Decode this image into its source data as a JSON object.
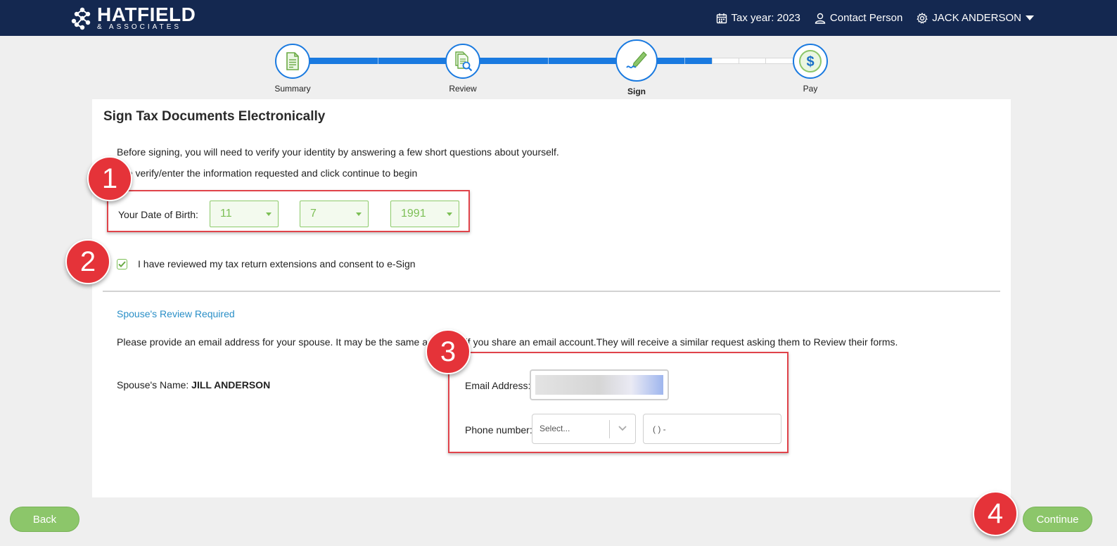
{
  "header": {
    "brand_name": "HATFIELD",
    "brand_sub": "& ASSOCIATES",
    "tax_year": "Tax year: 2023",
    "contact": "Contact Person",
    "user": "JACK ANDERSON"
  },
  "stepper": {
    "steps": [
      {
        "label": "Summary",
        "icon": "document-icon"
      },
      {
        "label": "Review",
        "icon": "review-search-icon"
      },
      {
        "label": "Sign",
        "icon": "pen-sign-icon",
        "active": true
      },
      {
        "label": "Pay",
        "icon": "dollar-icon"
      }
    ]
  },
  "main": {
    "title": "Sign Tax Documents Electronically",
    "intro1": "Before signing, you will need to verify your identity by answering a few short questions about yourself.",
    "intro2": "ase verify/enter the information requested and click continue to begin",
    "dob_label": "Your Date of Birth:",
    "dob": {
      "month": "11",
      "day": "7",
      "year": "1991"
    },
    "consent": {
      "checked": true,
      "label": "I have reviewed my tax return extensions and consent to e-Sign"
    },
    "spouse": {
      "heading": "Spouse's Review Required",
      "description": "Please provide an email address for your spouse. It may be the same as         n if you share an email account.They will receive a similar request asking them to Review their forms.",
      "name_label": "Spouse's Name:",
      "name": "JILL ANDERSON",
      "email_label": "Email Address:",
      "phone_label": "Phone number:",
      "phone_type_placeholder": "Select...",
      "phone_placeholder": "( ) -"
    }
  },
  "annotations": [
    "1",
    "2",
    "3",
    "4"
  ],
  "footer": {
    "back": "Back",
    "continue": "Continue"
  },
  "colors": {
    "header": "#142850",
    "accent": "#1a7ae0",
    "green": "#8cc66a",
    "highlight": "#e0434a"
  }
}
